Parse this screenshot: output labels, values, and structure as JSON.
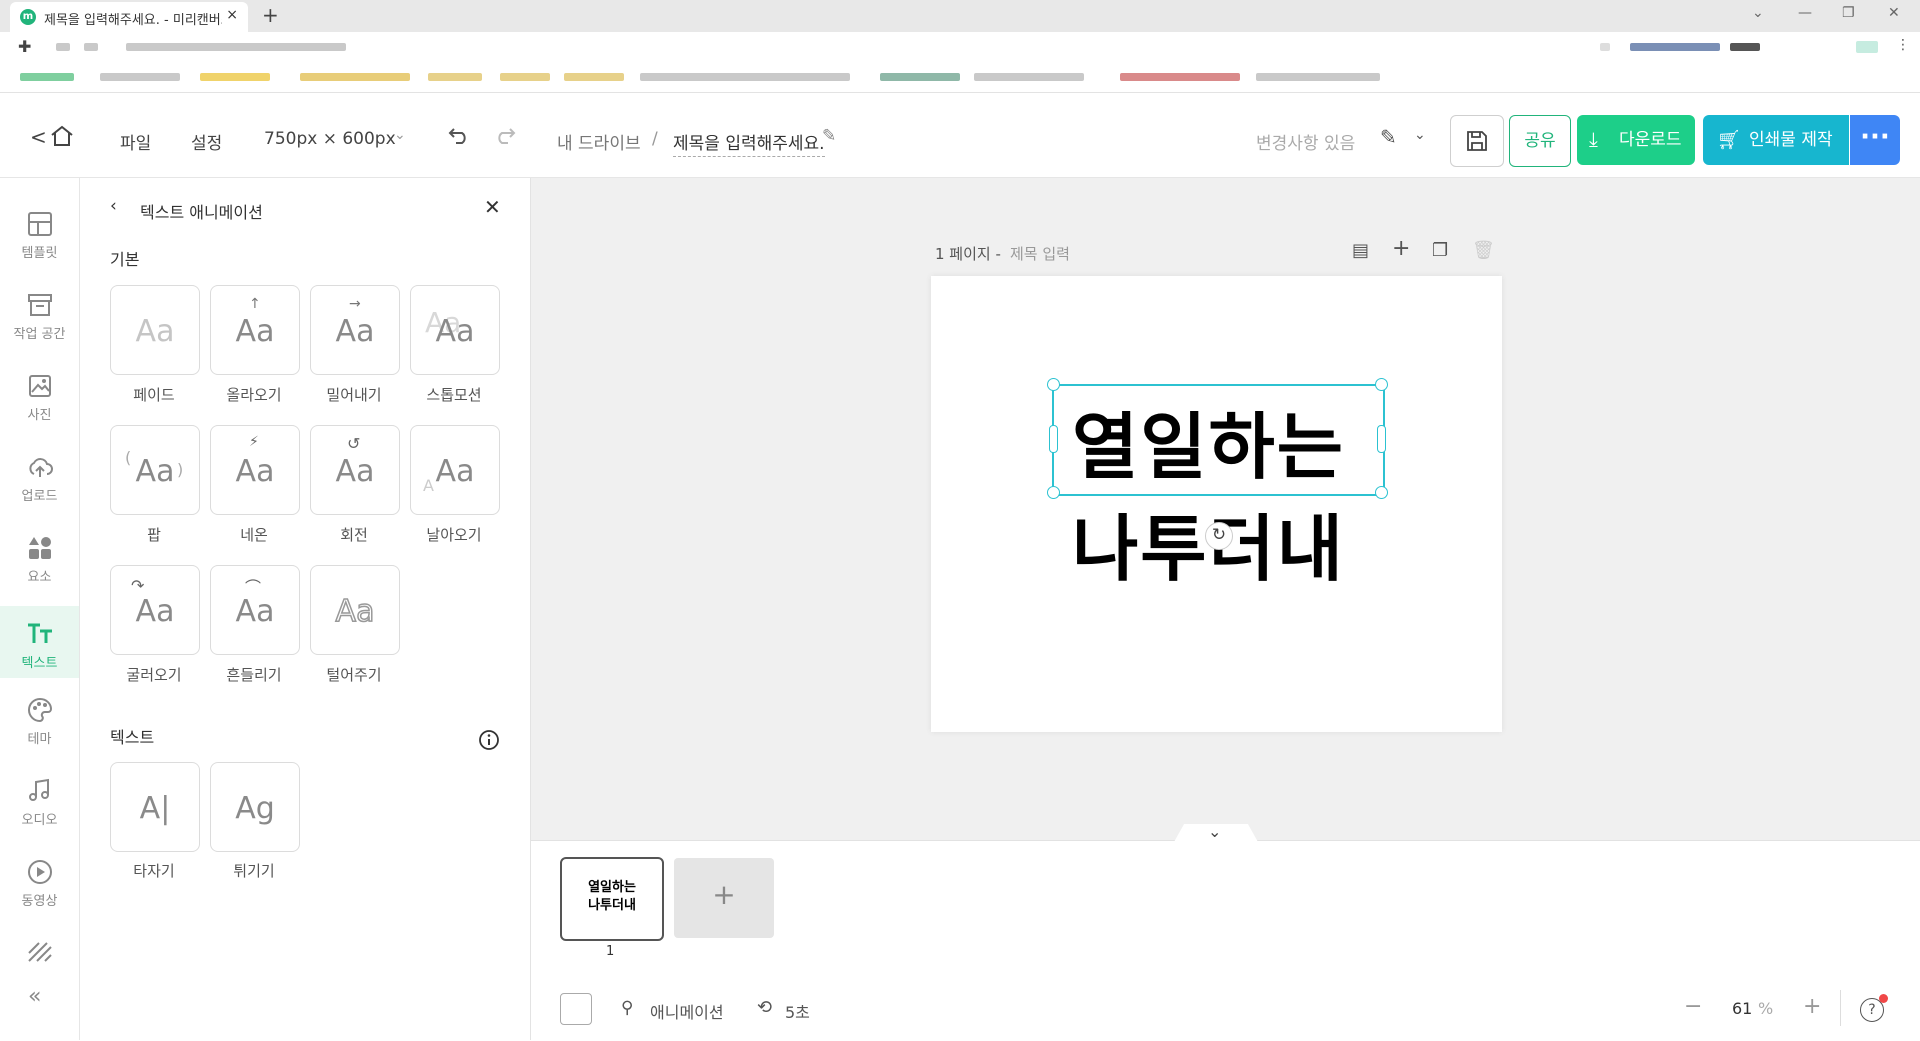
{
  "browser": {
    "tab_title": "제목을 입력해주세요. - 미리캔버스",
    "tab_close": "×",
    "new_tab": "+"
  },
  "header": {
    "back": "<",
    "menu_file": "파일",
    "menu_settings": "설정",
    "canvas_size": "750px × 600px",
    "breadcrumb_drive": "내 드라이브",
    "breadcrumb_sep": "/",
    "doc_title": "제목을 입력해주세요.",
    "save_status": "변경사항 있음",
    "share_label": "공유",
    "download_label": "다운로드",
    "print_label": "인쇄물 제작",
    "more_label": "···"
  },
  "rail": {
    "items": [
      {
        "label": "템플릿",
        "icon": "template-icon"
      },
      {
        "label": "작업 공간",
        "icon": "workspace-icon"
      },
      {
        "label": "사진",
        "icon": "photo-icon"
      },
      {
        "label": "업로드",
        "icon": "upload-icon"
      },
      {
        "label": "요소",
        "icon": "elements-icon"
      },
      {
        "label": "텍스트",
        "icon": "text-icon"
      },
      {
        "label": "테마",
        "icon": "theme-icon"
      },
      {
        "label": "오디오",
        "icon": "audio-icon"
      },
      {
        "label": "동영상",
        "icon": "video-icon"
      }
    ],
    "active_index": 5
  },
  "panel": {
    "title": "텍스트 애니메이션",
    "section_basic": "기본",
    "section_text": "텍스트",
    "basic_items": [
      {
        "label": "페이드",
        "glyph": "Aa"
      },
      {
        "label": "올라오기",
        "glyph": "Aa"
      },
      {
        "label": "밀어내기",
        "glyph": "Aa"
      },
      {
        "label": "스톱모션",
        "glyph": "Aa"
      },
      {
        "label": "팝",
        "glyph": "Aa"
      },
      {
        "label": "네온",
        "glyph": "Aa"
      },
      {
        "label": "회전",
        "glyph": "Aa"
      },
      {
        "label": "날아오기",
        "glyph": "Aa"
      },
      {
        "label": "굴러오기",
        "glyph": "Aa"
      },
      {
        "label": "흔들리기",
        "glyph": "Aa"
      },
      {
        "label": "털어주기",
        "glyph": "Aa"
      }
    ],
    "text_items": [
      {
        "label": "타자기",
        "glyph": "A|"
      },
      {
        "label": "튀기기",
        "glyph": "Ag"
      }
    ]
  },
  "workspace": {
    "page_label": "1 페이지 -",
    "page_title_placeholder": "제목 입력",
    "line1": "열일하는",
    "line2": "나투더내"
  },
  "bottom": {
    "thumb_line1": "열일하는",
    "thumb_line2": "나투더내",
    "thumb_number": "1",
    "add_page": "+",
    "animation_label": "애니메이션",
    "duration": "5초",
    "zoom_value": "61",
    "zoom_unit": "%",
    "zoom_minus": "−",
    "zoom_plus": "+"
  },
  "colors": {
    "brand_green": "#21b47b",
    "download_green": "#1dcf89",
    "print_teal": "#17b6cf",
    "more_blue": "#3f86f5",
    "selection": "#2cc2d1"
  }
}
